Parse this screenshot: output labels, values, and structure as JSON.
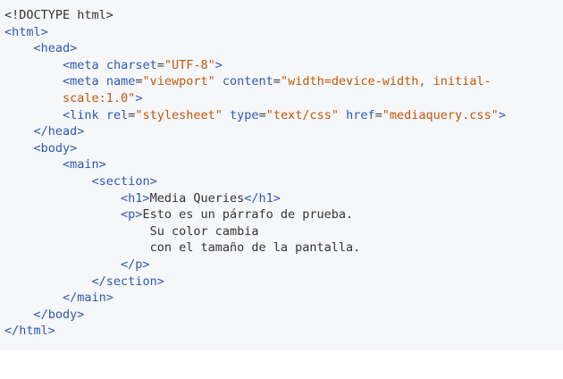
{
  "code": {
    "l1": {
      "text": "<!DOCTYPE html>"
    },
    "l2": {
      "tag": "<html>"
    },
    "l3": {
      "tag": "<head>"
    },
    "l4": {
      "open": "<meta",
      "a1": "charset",
      "v1": "\"UTF-8\"",
      "close": ">"
    },
    "l5": {
      "open": "<meta",
      "a1": "name",
      "v1": "\"viewport\"",
      "a2": "content",
      "v2": "\"width=device-width, initial-"
    },
    "l6": {
      "v": "scale:1.0\"",
      "close": ">"
    },
    "l7": {
      "open": "<link",
      "a1": "rel",
      "v1": "\"stylesheet\"",
      "a2": "type",
      "v2": "\"text/css\"",
      "a3": "href",
      "v3": "\"mediaquery.css\"",
      "close": ">"
    },
    "l8": {
      "tag": "</head>"
    },
    "l9": {
      "tag": "<body>"
    },
    "l10": {
      "tag": "<main>"
    },
    "l11": {
      "tag": "<section>"
    },
    "l12": {
      "open": "<h1>",
      "text": "Media Queries",
      "close": "</h1>"
    },
    "l13": {
      "open": "<p>",
      "text": "Esto es un párrafo de prueba."
    },
    "l14": {
      "text": "Su color cambia"
    },
    "l15": {
      "text": "con el tamaño de la pantalla."
    },
    "l16": {
      "tag": "</p>"
    },
    "l17": {
      "tag": "</section>"
    },
    "l18": {
      "tag": "</main>"
    },
    "l19": {
      "tag": "</body>"
    },
    "l20": {
      "tag": "</html>"
    }
  }
}
